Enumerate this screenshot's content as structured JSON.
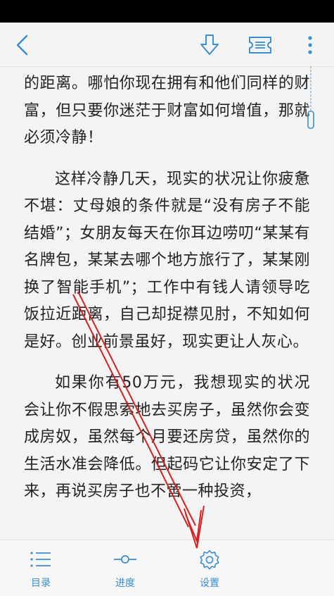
{
  "reader": {
    "paragraphs": [
      {
        "text": "的距离。哪怕你现在拥有和他们同样的财富，但只要你迷茫于财富如何增值，那就必须冷静！",
        "indent": false
      },
      {
        "text": "这样冷静几天，现实的状况让你疲惫不堪：丈母娘的条件就是“没有房子不能结婚”；女朋友每天在你耳边唠叨“某某有名牌包，某某去哪个地方旅行了，某某刚换了智能手机”；工作中有钱人请领导吃饭拉近距离，自己却捉襟见肘，不知如何是好。创业前景虽好，现实更让人灰心。",
        "indent": true
      },
      {
        "text": "如果你有50万元，我想现实的状况会让你不假思索地去买房子，虽然你会变成房奴，虽然每个月要还房贷，虽然你的生活水准会降低。但起码它让你安定了下来，再说买房子也不啻一种投资，",
        "indent": true
      }
    ]
  },
  "top_bar": {
    "back_icon": "chevron-left-icon",
    "download_icon": "download-arrow-icon",
    "ticket_icon": "ticket-icon",
    "more_icon": "more-vertical-icon"
  },
  "bottom_bar": {
    "tabs": [
      {
        "label": "目录",
        "icon": "list-icon"
      },
      {
        "label": "进度",
        "icon": "progress-slider-icon"
      },
      {
        "label": "设置",
        "icon": "gear-icon"
      }
    ]
  },
  "colors": {
    "accent": "#3a8ed4",
    "annotation_arrow": "#d42020",
    "page_bg": "#f4f4f4"
  }
}
